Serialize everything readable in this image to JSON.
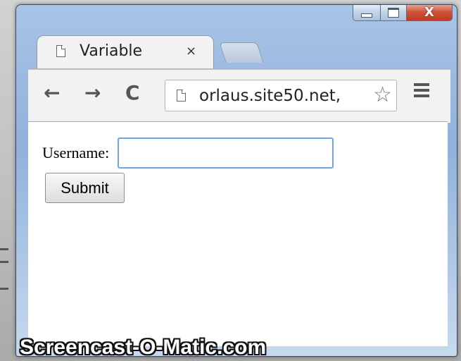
{
  "window": {
    "tab_title": "Variable",
    "tab_close": "×",
    "controls": {
      "minimize": "",
      "maximize": "",
      "close": "X"
    }
  },
  "toolbar": {
    "back": "←",
    "forward": "→",
    "reload": "C",
    "url": "orlaus.site50.net,",
    "star": "☆"
  },
  "page": {
    "username_label": "Username:",
    "username_value": "",
    "submit_label": "Submit"
  },
  "watermark": "Screencast-O-Matic.com"
}
